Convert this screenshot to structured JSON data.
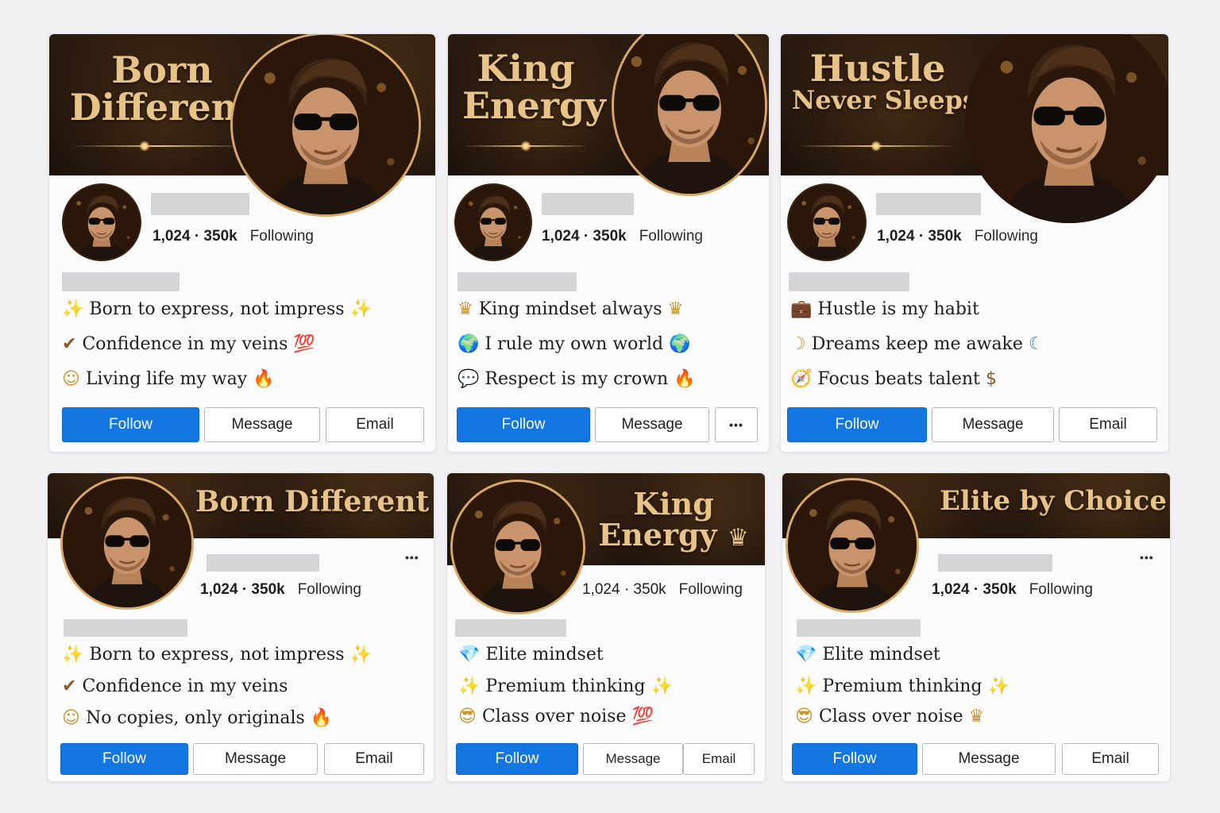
{
  "cards": [
    {
      "banner_lines": [
        "Born",
        "Different"
      ],
      "stats": "1,024 · 350k",
      "following_label": "Following",
      "bio": [
        {
          "icon": "sparkles-icon",
          "glyph": "✨",
          "text": "Born to express, not impress",
          "trail": "✨"
        },
        {
          "icon": "check-mark-icon",
          "glyph": "✔",
          "text": "Confidence in my veins",
          "trail": "💯"
        },
        {
          "icon": "smiley-icon",
          "glyph": "☺",
          "text": "Living life my way",
          "trail": "🔥"
        }
      ],
      "buttons": {
        "follow": "Follow",
        "message": "Message",
        "email": "Email"
      }
    },
    {
      "banner_lines": [
        "King",
        "Energy"
      ],
      "stats": "1,024 · 350k",
      "following_label": "Following",
      "bio": [
        {
          "icon": "crown-icon",
          "glyph": "♛",
          "text": "King mindset always",
          "trail": "♛"
        },
        {
          "icon": "globe-icon",
          "glyph": "🌍",
          "text": "I rule my own world",
          "trail": "🌍"
        },
        {
          "icon": "speech-bubble-icon",
          "glyph": "💬",
          "text": "Respect is my crown",
          "trail": "🔥"
        }
      ],
      "buttons": {
        "follow": "Follow",
        "message": "Message",
        "more": "•••"
      }
    },
    {
      "banner_lines": [
        "Hustle",
        "Never Sleeps"
      ],
      "stats": "1,024 · 350k",
      "following_label": "Following",
      "bio": [
        {
          "icon": "briefcase-icon",
          "glyph": "💼",
          "text": "Hustle is my habit",
          "trail": ""
        },
        {
          "icon": "crescent-moon-icon",
          "glyph": "☽",
          "text": "Dreams keep me awake",
          "trail": "☾"
        },
        {
          "icon": "compass-icon",
          "glyph": "🧭",
          "text": "Focus beats talent",
          "trail": "$"
        }
      ],
      "buttons": {
        "follow": "Follow",
        "message": "Message",
        "email": "Email"
      }
    },
    {
      "banner_lines": [
        "Born Different"
      ],
      "banner_emoji": "😎",
      "stats": "1,024 · 350k",
      "following_label": "Following",
      "more": "•••",
      "bio": [
        {
          "icon": "sparkles-icon",
          "glyph": "✨",
          "text": "Born to express, not impress",
          "trail": "✨"
        },
        {
          "icon": "check-mark-icon",
          "glyph": "✔",
          "text": "Confidence in my veins",
          "trail": ""
        },
        {
          "icon": "smiley-icon",
          "glyph": "☺",
          "text": "No copies, only originals",
          "trail": "🔥"
        }
      ],
      "buttons": {
        "follow": "Follow",
        "message": "Message",
        "email": "Email"
      }
    },
    {
      "banner_lines": [
        "King",
        "Energy"
      ],
      "banner_emoji": "♛",
      "stats": "1,024 · 350k",
      "following_label": "Following",
      "bio": [
        {
          "icon": "gem-icon",
          "glyph": "💎",
          "text": "Elite mindset",
          "trail": ""
        },
        {
          "icon": "sparkles-icon",
          "glyph": "✨",
          "text": "Premium thinking",
          "trail": "✨"
        },
        {
          "icon": "sunglasses-face-icon",
          "glyph": "😎",
          "text": "Class over noise",
          "trail": "💯"
        }
      ],
      "buttons": {
        "follow": "Follow",
        "message": "Message",
        "email": "Email"
      }
    },
    {
      "banner_lines": [
        "Elite by Choice"
      ],
      "banner_emoji": "💎",
      "stats": "1,024 · 350k",
      "following_label": "Following",
      "more": "•••",
      "bio": [
        {
          "icon": "gem-icon",
          "glyph": "💎",
          "text": "Elite mindset",
          "trail": ""
        },
        {
          "icon": "sparkles-icon",
          "glyph": "✨",
          "text": "Premium thinking",
          "trail": "✨"
        },
        {
          "icon": "sunglasses-face-icon",
          "glyph": "😎",
          "text": "Class over noise",
          "trail": "♛"
        }
      ],
      "buttons": {
        "follow": "Follow",
        "message": "Message",
        "email": "Email"
      }
    }
  ],
  "colors": {
    "accent_blue": "#1476e0",
    "gold": "#e8c387",
    "banner_dark": "#1b100a"
  }
}
